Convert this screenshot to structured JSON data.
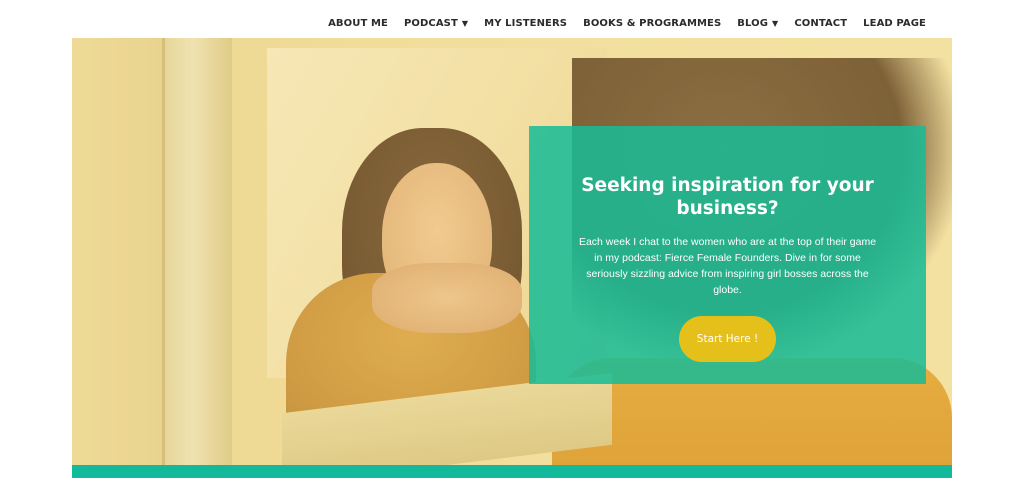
{
  "nav": {
    "items": [
      {
        "label": "ABOUT ME",
        "dropdown": false
      },
      {
        "label": "PODCAST",
        "dropdown": true
      },
      {
        "label": "MY LISTENERS",
        "dropdown": false
      },
      {
        "label": "BOOKS & PROGRAMMES",
        "dropdown": false
      },
      {
        "label": "BLOG",
        "dropdown": true
      },
      {
        "label": "CONTACT",
        "dropdown": false
      },
      {
        "label": "LEAD PAGE",
        "dropdown": false
      }
    ],
    "caret": "▼"
  },
  "hero": {
    "title": "Seeking inspiration for your business?",
    "text": "Each week I chat to the women who are at the top of their game in my podcast: Fierce Female Founders. Dive in for some seriously sizzling advice from inspiring girl bosses across the globe.",
    "button_label": "Start Here !"
  },
  "colors": {
    "card_bg": "#17bc96",
    "button_bg": "#e6c01a",
    "bar": "#13b99b",
    "nav_text": "#2b2b2b"
  }
}
